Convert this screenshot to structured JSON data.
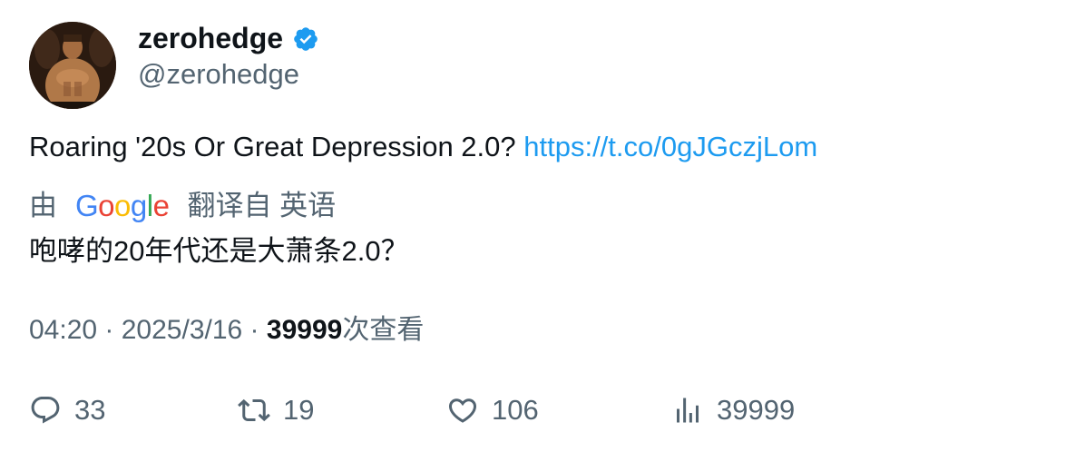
{
  "author": {
    "display_name": "zerohedge",
    "handle": "@zerohedge",
    "verified": true,
    "accent_color": "#1d9bf0"
  },
  "tweet": {
    "text": "Roaring '20s Or Great Depression 2.0? ",
    "link": "https://t.co/0gJGczjLom"
  },
  "translation": {
    "prefix": "由",
    "provider_letters": [
      "G",
      "o",
      "o",
      "g",
      "l",
      "e"
    ],
    "suffix": "翻译自 英语",
    "text": "咆哮的20年代还是大萧条2.0？"
  },
  "meta": {
    "time": "04:20",
    "separator": " · ",
    "date": "2025/3/16",
    "views_count": "39999",
    "views_label": "次查看"
  },
  "actions": {
    "replies": "33",
    "retweets": "19",
    "likes": "106",
    "views": "39999"
  }
}
